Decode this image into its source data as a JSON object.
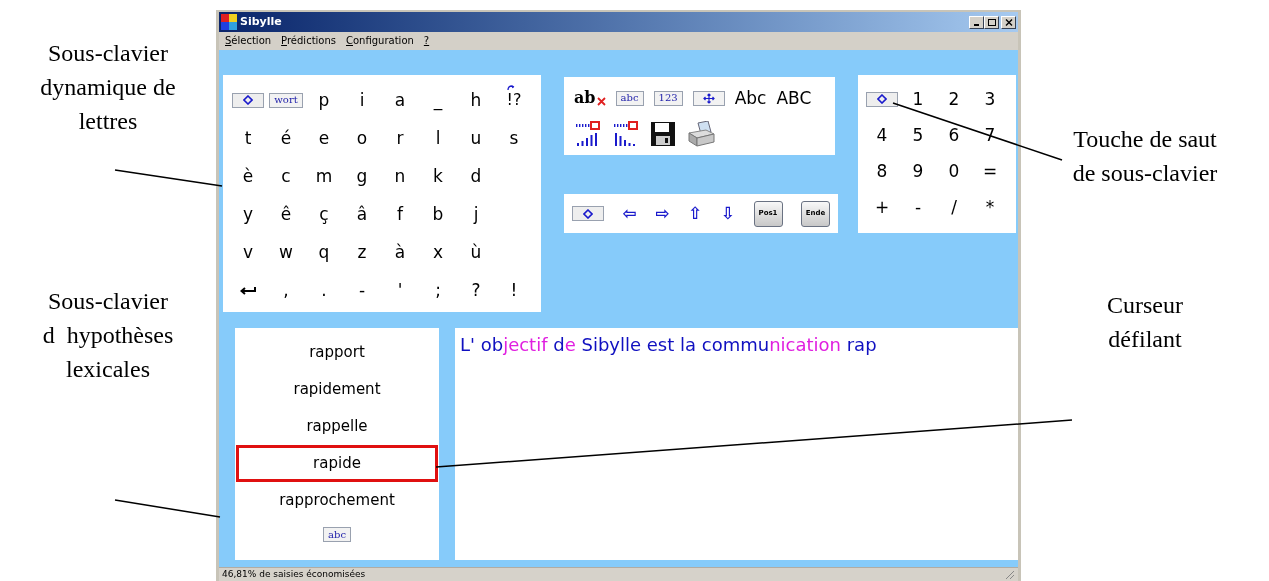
{
  "annotations": {
    "left_top": [
      "Sous-clavier",
      "dynamique de",
      "lettres"
    ],
    "left_bottom": [
      "Sous-clavier",
      "d  hypothèses",
      "lexicales"
    ],
    "right_top": [
      "Touche de saut",
      "de sous-clavier"
    ],
    "right_bottom": [
      "Curseur",
      "défilant"
    ]
  },
  "window": {
    "title": "Sibylle"
  },
  "menu": [
    "Sélection",
    "Prédictions",
    "Configuration",
    "?"
  ],
  "letters": [
    [
      {
        "kind": "jump"
      },
      {
        "kind": "tile",
        "label": "wort"
      },
      {
        "kind": "char",
        "label": "p"
      },
      {
        "kind": "char",
        "label": "i"
      },
      {
        "kind": "char",
        "label": "a"
      },
      {
        "kind": "char",
        "label": "_"
      },
      {
        "kind": "char",
        "label": "h"
      },
      {
        "kind": "cycle",
        "label": "!?"
      }
    ],
    [
      {
        "kind": "char",
        "label": "t"
      },
      {
        "kind": "char",
        "label": "é"
      },
      {
        "kind": "char",
        "label": "e"
      },
      {
        "kind": "char",
        "label": "o"
      },
      {
        "kind": "char",
        "label": "r"
      },
      {
        "kind": "char",
        "label": "l"
      },
      {
        "kind": "char",
        "label": "u"
      },
      {
        "kind": "char",
        "label": "s"
      }
    ],
    [
      {
        "kind": "char",
        "label": "è"
      },
      {
        "kind": "char",
        "label": "c"
      },
      {
        "kind": "char",
        "label": "m"
      },
      {
        "kind": "char",
        "label": "g"
      },
      {
        "kind": "char",
        "label": "n"
      },
      {
        "kind": "char",
        "label": "k"
      },
      {
        "kind": "char",
        "label": "d"
      }
    ],
    [
      {
        "kind": "char",
        "label": "y"
      },
      {
        "kind": "char",
        "label": "ê"
      },
      {
        "kind": "char",
        "label": "ç"
      },
      {
        "kind": "char",
        "label": "â"
      },
      {
        "kind": "char",
        "label": "f"
      },
      {
        "kind": "char",
        "label": "b"
      },
      {
        "kind": "char",
        "label": "j"
      }
    ],
    [
      {
        "kind": "char",
        "label": "v"
      },
      {
        "kind": "char",
        "label": "w"
      },
      {
        "kind": "char",
        "label": "q"
      },
      {
        "kind": "char",
        "label": "z"
      },
      {
        "kind": "char",
        "label": "à"
      },
      {
        "kind": "char",
        "label": "x"
      },
      {
        "kind": "char",
        "label": "ù"
      }
    ],
    [
      {
        "kind": "enter"
      },
      {
        "kind": "char",
        "label": ","
      },
      {
        "kind": "char",
        "label": "."
      },
      {
        "kind": "char",
        "label": "-"
      },
      {
        "kind": "char",
        "label": "'"
      },
      {
        "kind": "char",
        "label": ";"
      },
      {
        "kind": "char",
        "label": "?"
      },
      {
        "kind": "char",
        "label": "!"
      }
    ]
  ],
  "tools": [
    [
      {
        "kind": "spell",
        "label": "ab"
      },
      {
        "kind": "tile",
        "label": "abc"
      },
      {
        "kind": "tile",
        "label": "123"
      },
      {
        "kind": "move"
      },
      {
        "kind": "char",
        "label": "Abc"
      },
      {
        "kind": "char",
        "label": "ABC"
      }
    ],
    [
      {
        "kind": "bars-up"
      },
      {
        "kind": "bars-down"
      },
      {
        "kind": "save"
      },
      {
        "kind": "print"
      }
    ]
  ],
  "navigation": [
    {
      "kind": "jump"
    },
    {
      "kind": "arrow",
      "label": "⇦"
    },
    {
      "kind": "arrow",
      "label": "⇨"
    },
    {
      "kind": "arrow",
      "label": "⇧"
    },
    {
      "kind": "arrow",
      "label": "⇩"
    },
    {
      "kind": "keycap",
      "label": "Pos1"
    },
    {
      "kind": "keycap",
      "label": "Ende"
    }
  ],
  "numbers": [
    [
      {
        "kind": "jump"
      },
      {
        "kind": "char",
        "label": "1"
      },
      {
        "kind": "char",
        "label": "2"
      },
      {
        "kind": "char",
        "label": "3"
      }
    ],
    [
      {
        "kind": "char",
        "label": "4"
      },
      {
        "kind": "char",
        "label": "5"
      },
      {
        "kind": "char",
        "label": "6"
      },
      {
        "kind": "char",
        "label": "7"
      }
    ],
    [
      {
        "kind": "char",
        "label": "8"
      },
      {
        "kind": "char",
        "label": "9"
      },
      {
        "kind": "char",
        "label": "0"
      },
      {
        "kind": "char",
        "label": "="
      }
    ],
    [
      {
        "kind": "char",
        "label": "+"
      },
      {
        "kind": "char",
        "label": "-"
      },
      {
        "kind": "char",
        "label": "/"
      },
      {
        "kind": "char",
        "label": "*"
      }
    ]
  ],
  "hypotheses": [
    {
      "label": "rapport",
      "selected": false
    },
    {
      "label": "rapidement",
      "selected": false
    },
    {
      "label": "rappelle",
      "selected": false
    },
    {
      "label": "rapide",
      "selected": true
    },
    {
      "label": "rapprochement",
      "selected": false
    }
  ],
  "hypotheses_switch": {
    "label": "abc"
  },
  "editor": {
    "segments": [
      {
        "text": "L' ob",
        "color": "#1010c0"
      },
      {
        "text": "jectif",
        "color": "#e020e0"
      },
      {
        "text": " d",
        "color": "#1010c0"
      },
      {
        "text": "e",
        "color": "#e020e0"
      },
      {
        "text": " Sibylle est la commu",
        "color": "#1010c0"
      },
      {
        "text": "nication",
        "color": "#e020e0"
      },
      {
        "text": " rap",
        "color": "#1010c0"
      }
    ]
  },
  "status_bar": "46,81% de saisies économisées"
}
